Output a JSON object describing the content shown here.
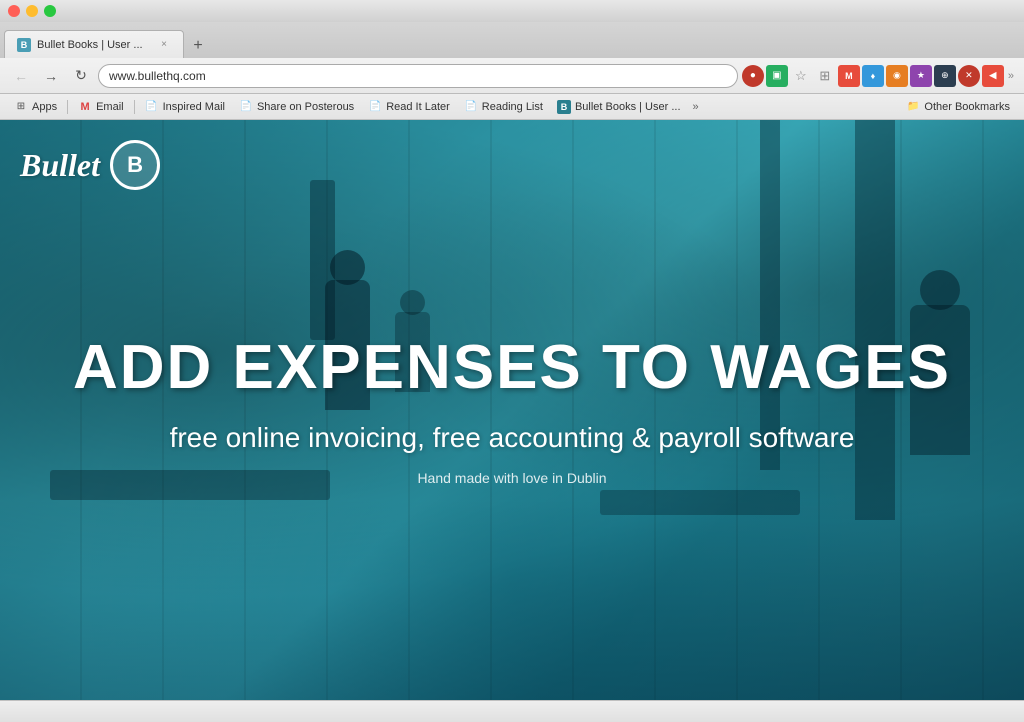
{
  "browser": {
    "url": "www.bullethq.com",
    "tab": {
      "favicon_text": "B",
      "title": "Bullet Books | User ..."
    },
    "nav": {
      "back_label": "←",
      "forward_label": "→",
      "reload_label": "↻",
      "home_label": "⌂"
    },
    "bookmarks": [
      {
        "id": "apps",
        "icon": "⊞",
        "label": "Apps",
        "type": "apps"
      },
      {
        "id": "gmail",
        "icon": "M",
        "label": "Email",
        "type": "gmail"
      },
      {
        "id": "inspired-mail",
        "icon": "✉",
        "label": "Inspired Mail",
        "type": "bookmark"
      },
      {
        "id": "share-on-posterous",
        "icon": "📌",
        "label": "Share on Posterous",
        "type": "bookmark"
      },
      {
        "id": "read-it-later",
        "icon": "📄",
        "label": "Read It Later",
        "type": "bookmark"
      },
      {
        "id": "reading-list",
        "icon": "📖",
        "label": "Reading List",
        "type": "bookmark"
      },
      {
        "id": "bullet-books",
        "icon": "B",
        "label": "Bullet Books | User ...",
        "type": "current"
      }
    ],
    "other_bookmarks_label": "Other Bookmarks"
  },
  "website": {
    "logo_text": "Bullet",
    "logo_circle_letter": "B",
    "headline": "ADD EXPENSES TO WAGES",
    "subheadline": "free online invoicing, free accounting & payroll software",
    "tagline": "Hand made with love in Dublin"
  },
  "status_bar": {
    "text": ""
  }
}
